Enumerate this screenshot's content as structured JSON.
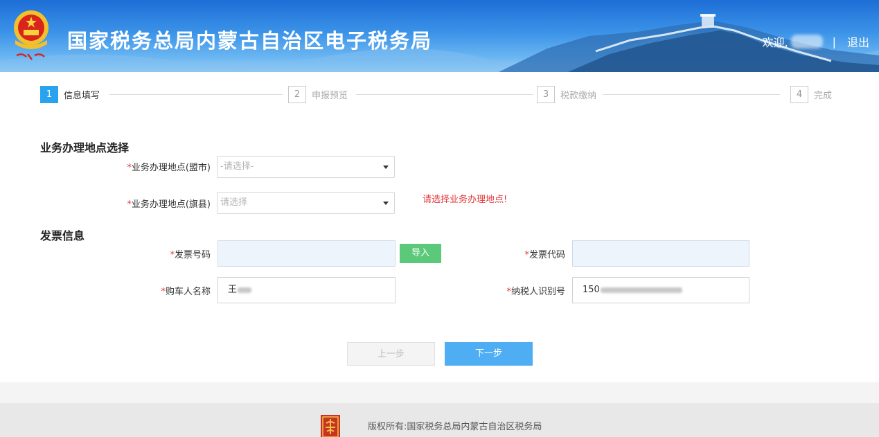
{
  "header": {
    "title": "国家税务总局内蒙古自治区电子税务局",
    "welcome": "欢迎,",
    "separator": "|",
    "logout": "退出"
  },
  "steps": [
    {
      "num": "1",
      "label": "信息填写",
      "active": true
    },
    {
      "num": "2",
      "label": "申报预览",
      "active": false
    },
    {
      "num": "3",
      "label": "税款缴纳",
      "active": false
    },
    {
      "num": "4",
      "label": "完成",
      "active": false
    }
  ],
  "location": {
    "section_title": "业务办理地点选择",
    "city_label": "业务办理地点(盟市)",
    "city_value": "-请选择-",
    "county_label": "业务办理地点(旗县)",
    "county_value": "请选择",
    "error": "请选择业务办理地点!"
  },
  "invoice": {
    "section_title": "发票信息",
    "number_label": "发票号码",
    "number_value": "",
    "import_button": "导入",
    "code_label": "发票代码",
    "code_value": "",
    "buyer_label": "购车人名称",
    "buyer_value": "王",
    "taxpayer_label": "纳税人识别号",
    "taxpayer_value": "150"
  },
  "required_mark": "*",
  "buttons": {
    "prev": "上一步",
    "next": "下一步"
  },
  "footer": {
    "copyright": "版权所有:国家税务总局内蒙古自治区税务局"
  },
  "colors": {
    "accent": "#2aa3ef",
    "primary_button": "#4eadf3",
    "import_button": "#5cc97a",
    "error": "#e4393c"
  }
}
